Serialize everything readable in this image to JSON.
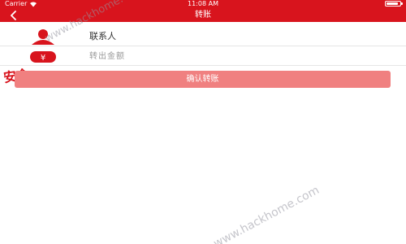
{
  "status_bar": {
    "carrier": "Carrier",
    "time": "11:08 AM",
    "battery_level": 0.9
  },
  "nav": {
    "title": "转账",
    "back_icon": "chevron-left-icon"
  },
  "form": {
    "contact_label": "联系人",
    "amount_placeholder": "转出金额"
  },
  "confirm": {
    "label": "确认转账"
  },
  "overlay": {
    "stamp_text": "安全",
    "watermark_top": "www.hackhome.com",
    "watermark_bottom": "www.hackhome.com"
  },
  "colors": {
    "brand": "#d8141d",
    "button": "#f08080"
  }
}
